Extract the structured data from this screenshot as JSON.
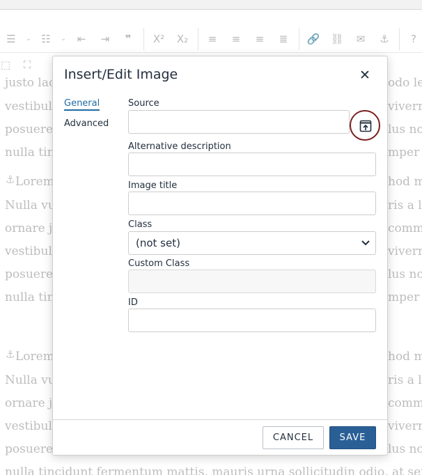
{
  "background": {
    "lines": [
      {
        "left": "justo lac",
        "right": "odo lec"
      },
      {
        "left": "vestibulu",
        "right": "viverra"
      },
      {
        "left": "posuere.",
        "right": "lus no"
      },
      {
        "left": "nulla tinc",
        "right": "mper n"
      },
      {
        "left": "Lorem",
        "right": "hod ma"
      },
      {
        "left": "Nulla vu",
        "right": "ris a lu"
      },
      {
        "left": "ornare ju",
        "right": "comm"
      },
      {
        "left": "vestibulu",
        "right": "viverra"
      },
      {
        "left": "posuere.",
        "right": "lus no"
      },
      {
        "left": "nulla tinc",
        "right": "mper n"
      },
      {
        "left": "Lorem",
        "right": "hod ma"
      },
      {
        "left": "Nulla vu",
        "right": "ris a lu"
      },
      {
        "left": "ornare ju",
        "right": "comm"
      },
      {
        "left": "vestibulu",
        "right": "viverra"
      },
      {
        "left": "posuere.",
        "right": "lus no"
      }
    ],
    "bottom_line": "nulla tincidunt fermentum mattis, mauris urna sollicitudin odio, at semper n"
  },
  "dialog": {
    "title": "Insert/Edit Image",
    "close_glyph": "✕",
    "tabs": [
      {
        "label": "General",
        "active": true
      },
      {
        "label": "Advanced",
        "active": false
      }
    ],
    "fields": {
      "source_label": "Source",
      "source_value": "",
      "alt_label": "Alternative description",
      "alt_value": "",
      "title_label": "Image title",
      "title_value": "",
      "class_label": "Class",
      "class_selected": "(not set)",
      "custom_class_label": "Custom Class",
      "custom_class_value": "",
      "id_label": "ID",
      "id_value": ""
    },
    "buttons": {
      "cancel": "CANCEL",
      "save": "SAVE"
    }
  },
  "colors": {
    "primary": "#2a5f96",
    "tab_active": "#206ba4",
    "browse_ring": "#7a1e1e",
    "text": "#222f3e"
  },
  "icons": {
    "browse": "browse-image-icon",
    "close": "close-icon",
    "select_chevron": "chevron-down-icon"
  }
}
